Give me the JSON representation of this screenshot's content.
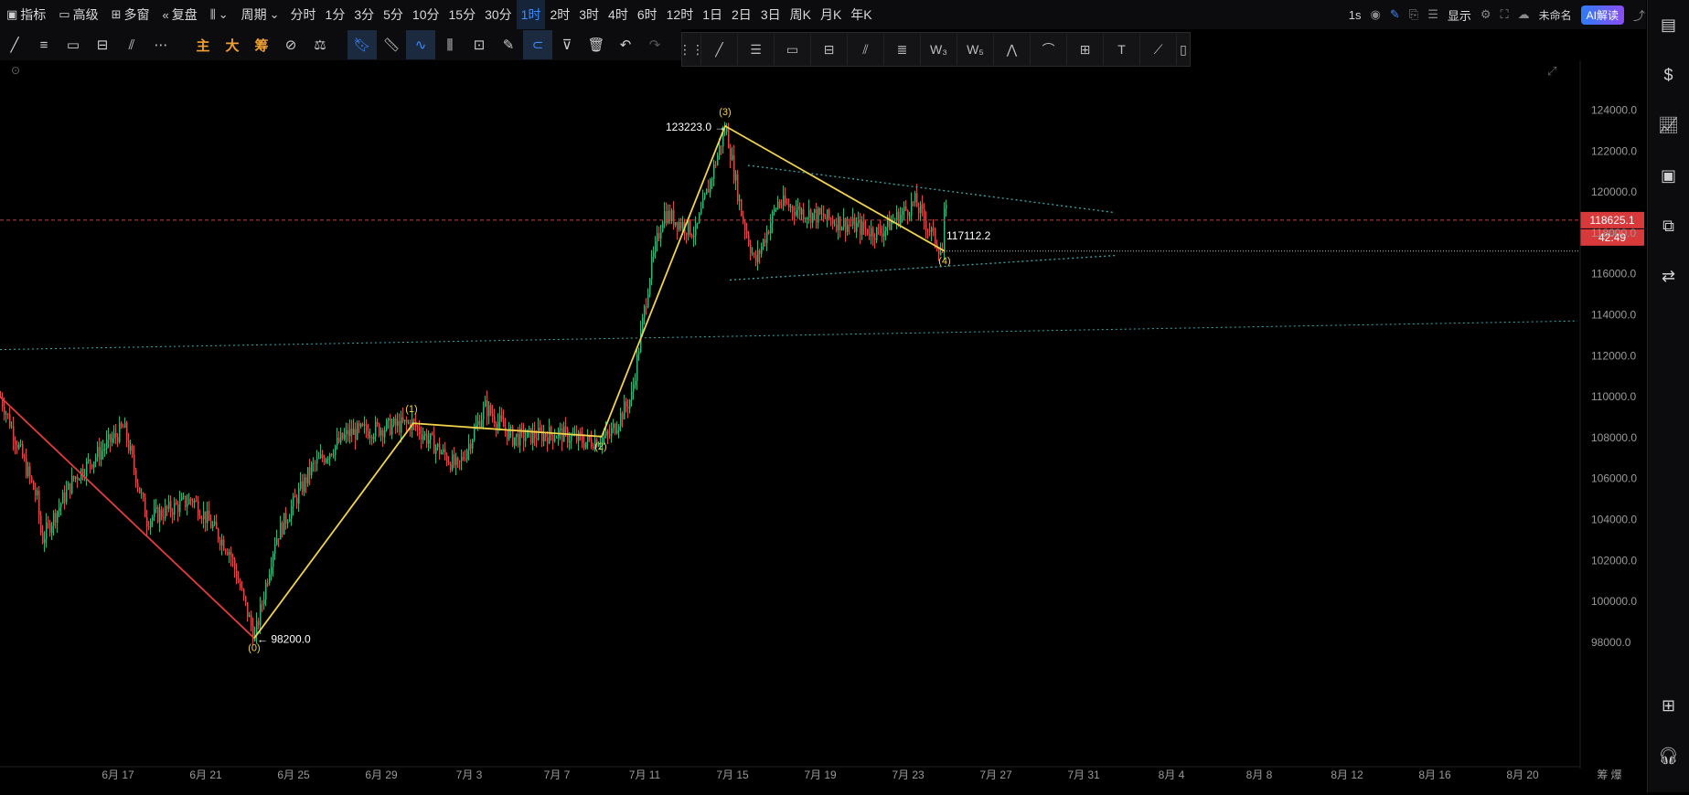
{
  "toolbar": {
    "indicators": "指标",
    "advanced": "高级",
    "multi_window": "多窗",
    "replay": "复盘",
    "period": "周期",
    "periods": [
      "分时",
      "1分",
      "3分",
      "5分",
      "10分",
      "15分",
      "30分",
      "1时",
      "2时",
      "3时",
      "4时",
      "6时",
      "12时",
      "1日",
      "2日",
      "3日",
      "周K",
      "月K",
      "年K"
    ],
    "active_period": "1时"
  },
  "right_tools": {
    "interval": "1s",
    "display": "显示",
    "unnamed": "未命名",
    "ai": "AI解读"
  },
  "toolbar2": {
    "main": "主",
    "big": "大",
    "chips": "筹"
  },
  "chart_data": {
    "type": "candlestick",
    "y_ticks": [
      "124000.0",
      "122000.0",
      "120000.0",
      "118000.0",
      "116000.0",
      "114000.0",
      "112000.0",
      "110000.0",
      "108000.0",
      "106000.0",
      "104000.0",
      "102000.0",
      "100000.0",
      "98000.0"
    ],
    "ylim": [
      97000,
      125200
    ],
    "x_ticks": [
      "6月 17",
      "6月 21",
      "6月 25",
      "6月 29",
      "7月 3",
      "7月 7",
      "7月 11",
      "7月 15",
      "7月 19",
      "7月 23",
      "7月 27",
      "7月 31",
      "8月 4",
      "8月 8",
      "8月 12",
      "8月 16",
      "8月 20"
    ],
    "current_price": "118625.1",
    "countdown": "42:49",
    "wave_labels": [
      {
        "label": "(0)",
        "price": 98200.0
      },
      {
        "label": "(1)",
        "price": 108700
      },
      {
        "label": "(2)",
        "price": 108050
      },
      {
        "label": "(3)",
        "price": 123223.0
      },
      {
        "label": "(4)",
        "price": 117112.2
      }
    ],
    "annotations": [
      "123223.0",
      "98200.0",
      "117112.2"
    ],
    "bottom_right": [
      "筹",
      "爆"
    ]
  }
}
